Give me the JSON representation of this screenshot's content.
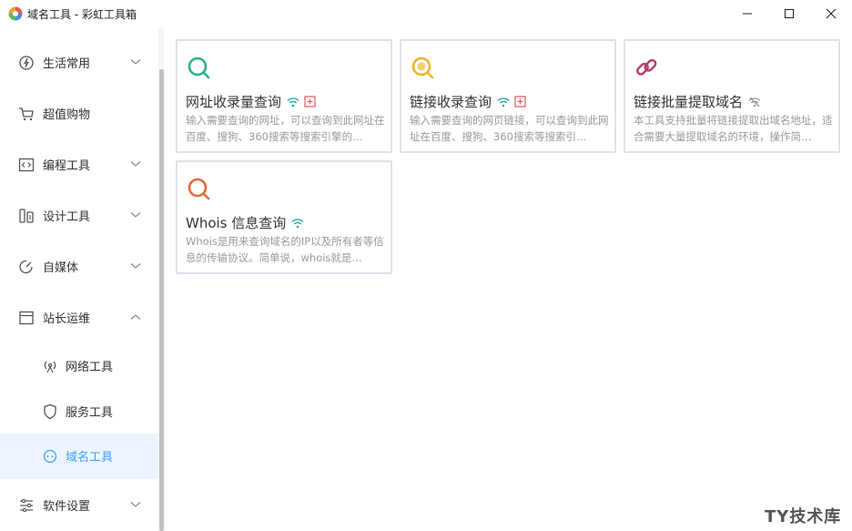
{
  "window": {
    "title": "域名工具 - 彩虹工具箱"
  },
  "sidebar": {
    "items": [
      {
        "label": "生活常用",
        "icon": "compass-icon",
        "expandable": true
      },
      {
        "label": "超值购物",
        "icon": "cart-icon",
        "expandable": false
      },
      {
        "label": "编程工具",
        "icon": "code-icon",
        "expandable": true
      },
      {
        "label": "设计工具",
        "icon": "palette-icon",
        "expandable": true
      },
      {
        "label": "自媒体",
        "icon": "media-icon",
        "expandable": true
      },
      {
        "label": "站长运维",
        "icon": "browser-icon",
        "expandable": true,
        "expanded": true
      },
      {
        "label": "软件设置",
        "icon": "sliders-icon",
        "expandable": true
      }
    ],
    "subitems": [
      {
        "label": "网络工具",
        "icon": "antenna-icon"
      },
      {
        "label": "服务工具",
        "icon": "shield-icon"
      },
      {
        "label": "域名工具",
        "icon": "domain-icon",
        "active": true
      }
    ]
  },
  "cards": [
    {
      "title": "网址收录量查询",
      "desc": "输入需要查询的网址，可以查询到此网址在百度、搜狗、360搜索等搜索引擎的…",
      "icon": "search-icon",
      "color": "#2bb08a",
      "online": true,
      "add": true
    },
    {
      "title": "链接收录查询",
      "desc": "输入需要查询的网页链接，可以查询到此网址在百度、搜狗、360搜索等搜索引…",
      "icon": "search-icon",
      "color": "#f0b429",
      "online": true,
      "add": true
    },
    {
      "title": "链接批量提取域名",
      "desc": "本工具支持批量将链接提取出域名地址，适合需要大量提取域名的环境，操作简…",
      "icon": "link-icon",
      "color": "#b03a6e",
      "online": false,
      "add": false
    },
    {
      "title": "Whois 信息查询",
      "desc": "Whois是用来查询域名的IP以及所有者等信息的传输协议。简单说，whois就是…",
      "icon": "search-icon",
      "color": "#e06a3b",
      "online": true,
      "add": false
    }
  ],
  "watermark": "TY技术库",
  "colors": {
    "accent": "#409eff",
    "online": "#2aa7a0",
    "offline": "#999999",
    "add": "#e05a5a"
  }
}
